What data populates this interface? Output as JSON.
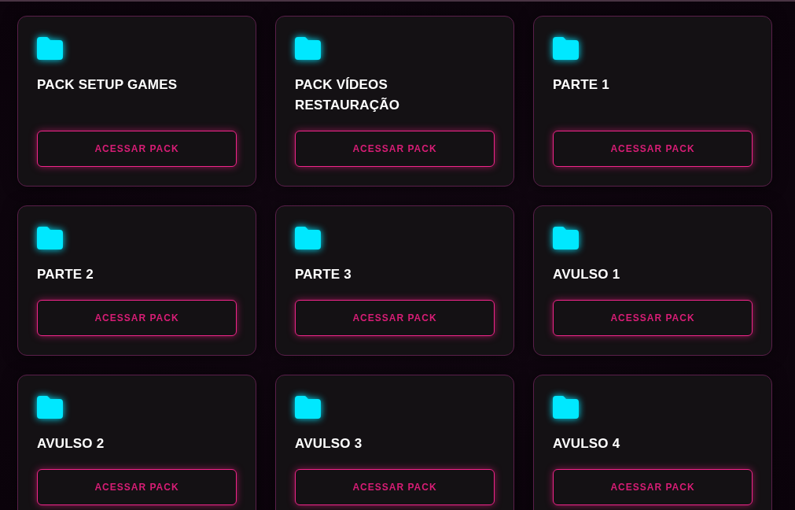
{
  "cards": [
    {
      "title": "PACK SETUP GAMES",
      "button": "ACESSAR PACK"
    },
    {
      "title": "PACK VÍDEOS RESTAURAÇÃO",
      "button": "ACESSAR PACK"
    },
    {
      "title": "PARTE 1",
      "button": "ACESSAR PACK"
    },
    {
      "title": "PARTE 2",
      "button": "ACESSAR PACK"
    },
    {
      "title": "PARTE 3",
      "button": "ACESSAR PACK"
    },
    {
      "title": "AVULSO 1",
      "button": "ACESSAR PACK"
    },
    {
      "title": "AVULSO 2",
      "button": "ACESSAR PACK"
    },
    {
      "title": "AVULSO 3",
      "button": "ACESSAR PACK"
    },
    {
      "title": "AVULSO 4",
      "button": "ACESSAR PACK"
    }
  ]
}
